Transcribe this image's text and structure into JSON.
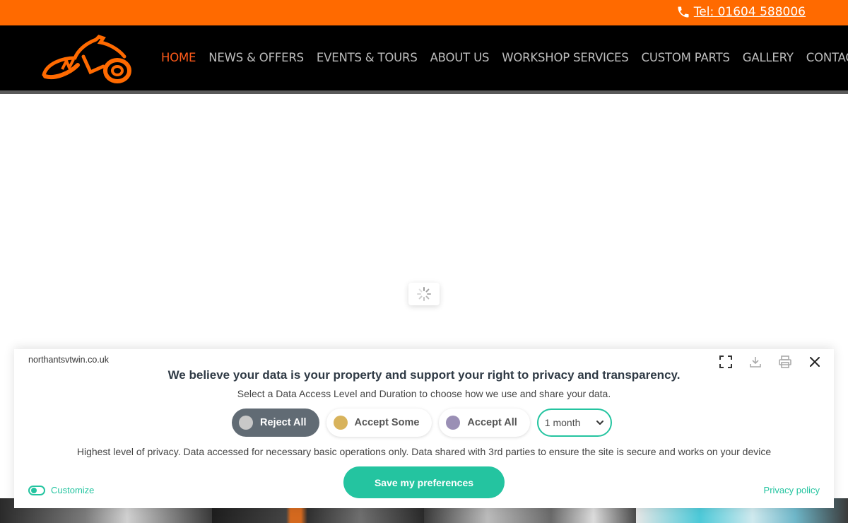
{
  "topbar": {
    "phone_label": "Tel: 01604 588006"
  },
  "nav": {
    "items": [
      {
        "label": "HOME",
        "active": true
      },
      {
        "label": "NEWS & OFFERS"
      },
      {
        "label": "EVENTS & TOURS"
      },
      {
        "label": "ABOUT US"
      },
      {
        "label": "WORKSHOP SERVICES"
      },
      {
        "label": "CUSTOM PARTS"
      },
      {
        "label": "GALLERY"
      },
      {
        "label": "CONTACT US"
      }
    ]
  },
  "colors": {
    "brand": "#ff6a00",
    "accent": "#24c4a0",
    "header_bg": "#000000",
    "nav_active": "#ff5a1a"
  },
  "privacy": {
    "site": "northantsvtwin.co.uk",
    "headline": "We believe your data is your property and support your right to privacy and transparency.",
    "subline": "Select a Data Access Level and Duration to choose how we use and share your data.",
    "options": [
      {
        "label": "Reject All",
        "dot_color": "#c8c8c8",
        "selected": true
      },
      {
        "label": "Accept Some",
        "dot_color": "#d8b35c"
      },
      {
        "label": "Accept All",
        "dot_color": "#9a8fb5"
      }
    ],
    "duration_value": "1 month",
    "description": "Highest level of privacy. Data accessed for necessary basic operations only. Data shared with 3rd parties to ensure the site is secure and works on your device",
    "save_label": "Save my preferences",
    "customize_label": "Customize",
    "policy_label": "Privacy policy"
  }
}
